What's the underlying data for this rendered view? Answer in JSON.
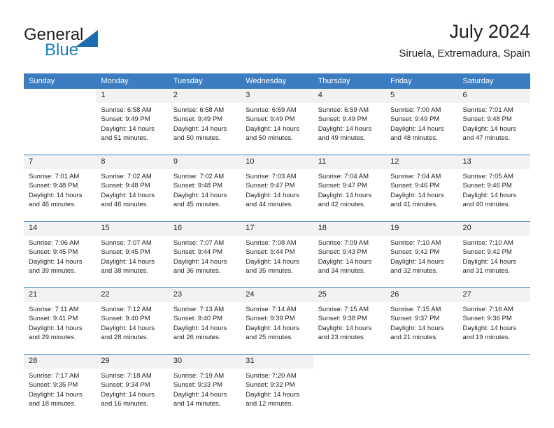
{
  "brand": {
    "word1": "General",
    "word2": "Blue",
    "logo_icon": "triangle-logo-icon",
    "blue_hex": "#1b7ec2",
    "triangle_hex": "#1b6cb0"
  },
  "header": {
    "title": "July 2024",
    "subtitle": "Siruela, Extremadura, Spain"
  },
  "theme": {
    "header_row_bg": "#3b7dc0",
    "daynum_bg": "#f2f2f2",
    "text": "#231f20"
  },
  "weekday_headers": [
    "Sunday",
    "Monday",
    "Tuesday",
    "Wednesday",
    "Thursday",
    "Friday",
    "Saturday"
  ],
  "weeks": [
    {
      "days": [
        {
          "num": "",
          "lines": []
        },
        {
          "num": "1",
          "lines": [
            "Sunrise: 6:58 AM",
            "Sunset: 9:49 PM",
            "Daylight: 14 hours",
            "and 51 minutes."
          ]
        },
        {
          "num": "2",
          "lines": [
            "Sunrise: 6:58 AM",
            "Sunset: 9:49 PM",
            "Daylight: 14 hours",
            "and 50 minutes."
          ]
        },
        {
          "num": "3",
          "lines": [
            "Sunrise: 6:59 AM",
            "Sunset: 9:49 PM",
            "Daylight: 14 hours",
            "and 50 minutes."
          ]
        },
        {
          "num": "4",
          "lines": [
            "Sunrise: 6:59 AM",
            "Sunset: 9:49 PM",
            "Daylight: 14 hours",
            "and 49 minutes."
          ]
        },
        {
          "num": "5",
          "lines": [
            "Sunrise: 7:00 AM",
            "Sunset: 9:49 PM",
            "Daylight: 14 hours",
            "and 48 minutes."
          ]
        },
        {
          "num": "6",
          "lines": [
            "Sunrise: 7:01 AM",
            "Sunset: 9:48 PM",
            "Daylight: 14 hours",
            "and 47 minutes."
          ]
        }
      ]
    },
    {
      "days": [
        {
          "num": "7",
          "lines": [
            "Sunrise: 7:01 AM",
            "Sunset: 9:48 PM",
            "Daylight: 14 hours",
            "and 46 minutes."
          ]
        },
        {
          "num": "8",
          "lines": [
            "Sunrise: 7:02 AM",
            "Sunset: 9:48 PM",
            "Daylight: 14 hours",
            "and 46 minutes."
          ]
        },
        {
          "num": "9",
          "lines": [
            "Sunrise: 7:02 AM",
            "Sunset: 9:48 PM",
            "Daylight: 14 hours",
            "and 45 minutes."
          ]
        },
        {
          "num": "10",
          "lines": [
            "Sunrise: 7:03 AM",
            "Sunset: 9:47 PM",
            "Daylight: 14 hours",
            "and 44 minutes."
          ]
        },
        {
          "num": "11",
          "lines": [
            "Sunrise: 7:04 AM",
            "Sunset: 9:47 PM",
            "Daylight: 14 hours",
            "and 42 minutes."
          ]
        },
        {
          "num": "12",
          "lines": [
            "Sunrise: 7:04 AM",
            "Sunset: 9:46 PM",
            "Daylight: 14 hours",
            "and 41 minutes."
          ]
        },
        {
          "num": "13",
          "lines": [
            "Sunrise: 7:05 AM",
            "Sunset: 9:46 PM",
            "Daylight: 14 hours",
            "and 40 minutes."
          ]
        }
      ]
    },
    {
      "days": [
        {
          "num": "14",
          "lines": [
            "Sunrise: 7:06 AM",
            "Sunset: 9:45 PM",
            "Daylight: 14 hours",
            "and 39 minutes."
          ]
        },
        {
          "num": "15",
          "lines": [
            "Sunrise: 7:07 AM",
            "Sunset: 9:45 PM",
            "Daylight: 14 hours",
            "and 38 minutes."
          ]
        },
        {
          "num": "16",
          "lines": [
            "Sunrise: 7:07 AM",
            "Sunset: 9:44 PM",
            "Daylight: 14 hours",
            "and 36 minutes."
          ]
        },
        {
          "num": "17",
          "lines": [
            "Sunrise: 7:08 AM",
            "Sunset: 9:44 PM",
            "Daylight: 14 hours",
            "and 35 minutes."
          ]
        },
        {
          "num": "18",
          "lines": [
            "Sunrise: 7:09 AM",
            "Sunset: 9:43 PM",
            "Daylight: 14 hours",
            "and 34 minutes."
          ]
        },
        {
          "num": "19",
          "lines": [
            "Sunrise: 7:10 AM",
            "Sunset: 9:42 PM",
            "Daylight: 14 hours",
            "and 32 minutes."
          ]
        },
        {
          "num": "20",
          "lines": [
            "Sunrise: 7:10 AM",
            "Sunset: 9:42 PM",
            "Daylight: 14 hours",
            "and 31 minutes."
          ]
        }
      ]
    },
    {
      "days": [
        {
          "num": "21",
          "lines": [
            "Sunrise: 7:11 AM",
            "Sunset: 9:41 PM",
            "Daylight: 14 hours",
            "and 29 minutes."
          ]
        },
        {
          "num": "22",
          "lines": [
            "Sunrise: 7:12 AM",
            "Sunset: 9:40 PM",
            "Daylight: 14 hours",
            "and 28 minutes."
          ]
        },
        {
          "num": "23",
          "lines": [
            "Sunrise: 7:13 AM",
            "Sunset: 9:40 PM",
            "Daylight: 14 hours",
            "and 26 minutes."
          ]
        },
        {
          "num": "24",
          "lines": [
            "Sunrise: 7:14 AM",
            "Sunset: 9:39 PM",
            "Daylight: 14 hours",
            "and 25 minutes."
          ]
        },
        {
          "num": "25",
          "lines": [
            "Sunrise: 7:15 AM",
            "Sunset: 9:38 PM",
            "Daylight: 14 hours",
            "and 23 minutes."
          ]
        },
        {
          "num": "26",
          "lines": [
            "Sunrise: 7:15 AM",
            "Sunset: 9:37 PM",
            "Daylight: 14 hours",
            "and 21 minutes."
          ]
        },
        {
          "num": "27",
          "lines": [
            "Sunrise: 7:16 AM",
            "Sunset: 9:36 PM",
            "Daylight: 14 hours",
            "and 19 minutes."
          ]
        }
      ]
    },
    {
      "days": [
        {
          "num": "28",
          "lines": [
            "Sunrise: 7:17 AM",
            "Sunset: 9:35 PM",
            "Daylight: 14 hours",
            "and 18 minutes."
          ]
        },
        {
          "num": "29",
          "lines": [
            "Sunrise: 7:18 AM",
            "Sunset: 9:34 PM",
            "Daylight: 14 hours",
            "and 16 minutes."
          ]
        },
        {
          "num": "30",
          "lines": [
            "Sunrise: 7:19 AM",
            "Sunset: 9:33 PM",
            "Daylight: 14 hours",
            "and 14 minutes."
          ]
        },
        {
          "num": "31",
          "lines": [
            "Sunrise: 7:20 AM",
            "Sunset: 9:32 PM",
            "Daylight: 14 hours",
            "and 12 minutes."
          ]
        },
        {
          "num": "",
          "lines": []
        },
        {
          "num": "",
          "lines": []
        },
        {
          "num": "",
          "lines": []
        }
      ]
    }
  ]
}
